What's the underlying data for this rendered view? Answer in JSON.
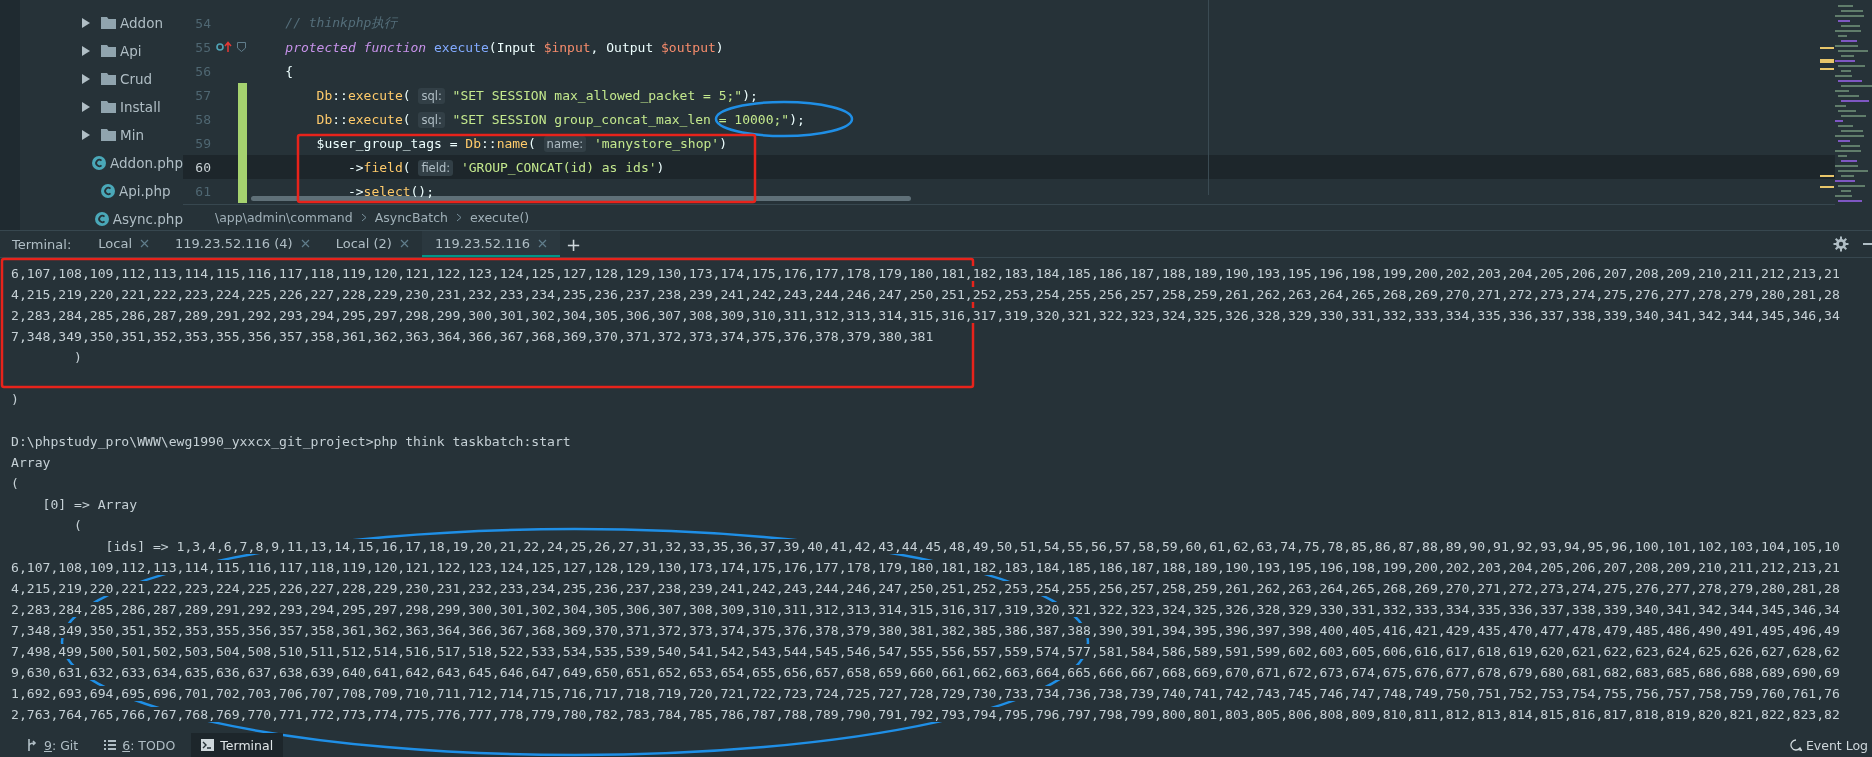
{
  "project_tree": {
    "items": [
      {
        "label": "Addon",
        "kind": "folder"
      },
      {
        "label": "Api",
        "kind": "folder"
      },
      {
        "label": "Crud",
        "kind": "folder"
      },
      {
        "label": "Install",
        "kind": "folder"
      },
      {
        "label": "Min",
        "kind": "folder"
      },
      {
        "label": "Addon.php",
        "kind": "class_file"
      },
      {
        "label": "Api.php",
        "kind": "class_file"
      },
      {
        "label": "Async.php",
        "kind": "class_file"
      }
    ]
  },
  "editor": {
    "lines": [
      {
        "number": "54",
        "changed": false,
        "current": false,
        "override": false,
        "tokens": [
          {
            "kind": "comment",
            "t": "    // thinkphp执行"
          }
        ]
      },
      {
        "number": "55",
        "changed": false,
        "current": false,
        "override": true,
        "tokens": [
          {
            "kind": "keyword",
            "t": "    protected"
          },
          {
            "kind": "keyword",
            "t": " function"
          },
          {
            "kind": "decl",
            "t": " execute"
          },
          {
            "kind": "plain",
            "t": "(Input "
          },
          {
            "kind": "var",
            "t": "$input"
          },
          {
            "kind": "plain",
            "t": ", Output "
          },
          {
            "kind": "var",
            "t": "$output"
          },
          {
            "kind": "plain",
            "t": ")"
          }
        ]
      },
      {
        "number": "56",
        "changed": false,
        "current": false,
        "override": false,
        "tokens": [
          {
            "kind": "plain",
            "t": "    {"
          }
        ]
      },
      {
        "number": "57",
        "changed": true,
        "current": false,
        "override": false,
        "tokens": [
          {
            "kind": "class",
            "t": "        Db"
          },
          {
            "kind": "plain",
            "t": "::"
          },
          {
            "kind": "method",
            "t": "execute"
          },
          {
            "kind": "plain",
            "t": "( "
          },
          {
            "kind": "hint",
            "t": "sql:"
          },
          {
            "kind": "string",
            "t": " \"SET SESSION max_allowed_packet = 5;\""
          },
          {
            "kind": "plain",
            "t": ");"
          }
        ]
      },
      {
        "number": "58",
        "changed": true,
        "current": false,
        "override": false,
        "tokens": [
          {
            "kind": "class",
            "t": "        Db"
          },
          {
            "kind": "plain",
            "t": "::"
          },
          {
            "kind": "method",
            "t": "execute"
          },
          {
            "kind": "plain",
            "t": "( "
          },
          {
            "kind": "hint",
            "t": "sql:"
          },
          {
            "kind": "string",
            "t": " \"SET SESSION group_concat_max_len = 10000;\""
          },
          {
            "kind": "plain",
            "t": ");"
          }
        ]
      },
      {
        "number": "59",
        "changed": true,
        "current": false,
        "override": false,
        "tokens": [
          {
            "kind": "plain",
            "t": "        $user_group_tags = "
          },
          {
            "kind": "class",
            "t": "Db"
          },
          {
            "kind": "plain",
            "t": "::"
          },
          {
            "kind": "method",
            "t": "name"
          },
          {
            "kind": "plain",
            "t": "( "
          },
          {
            "kind": "hint",
            "t": "name:"
          },
          {
            "kind": "string",
            "t": " 'manystore_shop'"
          },
          {
            "kind": "plain",
            "t": ")"
          }
        ]
      },
      {
        "number": "60",
        "changed": true,
        "current": true,
        "override": false,
        "tokens": [
          {
            "kind": "plain",
            "t": "            ->"
          },
          {
            "kind": "method",
            "t": "field"
          },
          {
            "kind": "plain",
            "t": "( "
          },
          {
            "kind": "hint",
            "t": "field:"
          },
          {
            "kind": "string",
            "t": " 'GROUP_CONCAT(id) as ids'"
          },
          {
            "kind": "plain",
            "t": ")"
          }
        ]
      },
      {
        "number": "61",
        "changed": true,
        "current": false,
        "override": false,
        "tokens": [
          {
            "kind": "plain",
            "t": "            ->"
          },
          {
            "kind": "method",
            "t": "select"
          },
          {
            "kind": "plain",
            "t": "();"
          }
        ]
      }
    ]
  },
  "breadcrumb": [
    "\\app\\admin\\command",
    "AsyncBatch",
    "execute()"
  ],
  "terminal": {
    "label": "Terminal:",
    "tabs": [
      {
        "label": "Local",
        "selected": false
      },
      {
        "label": "119.23.52.116 (4)",
        "selected": false
      },
      {
        "label": "Local (2)",
        "selected": false
      },
      {
        "label": "119.23.52.116",
        "selected": true
      }
    ],
    "add": "+",
    "blocks": [
      {
        "lines": [
          "6,107,108,109,112,113,114,115,116,117,118,119,120,121,122,123,124,125,127,128,129,130,173,174,175,176,177,178,179,180,181,182,183,184,185,186,187,188,189,190,193,195,196,198,199,200,202,203,204,205,206,207,208,209,210,211,212,213,21",
          "4,215,219,220,221,222,223,224,225,226,227,228,229,230,231,232,233,234,235,236,237,238,239,241,242,243,244,246,247,250,251,252,253,254,255,256,257,258,259,261,262,263,264,265,268,269,270,271,272,273,274,275,276,277,278,279,280,281,28",
          "2,283,284,285,286,287,289,291,292,293,294,295,297,298,299,300,301,302,304,305,306,307,308,309,310,311,312,313,314,315,316,317,319,320,321,322,323,324,325,326,328,329,330,331,332,333,334,335,336,337,338,339,340,341,342,344,345,346,34",
          "7,348,349,350,351,352,353,355,356,357,358,361,362,363,364,366,367,368,369,370,371,372,373,374,375,376,378,379,380,381",
          "        )"
        ]
      },
      {
        "lines": [
          ")"
        ]
      },
      {
        "lines": [
          "D:\\phpstudy_pro\\WWW\\ewg1990_yxxcx_git_project>php think taskbatch:start",
          "Array",
          "(",
          "    [0] => Array",
          "        (",
          "            [ids] => 1,3,4,6,7,8,9,11,13,14,15,16,17,18,19,20,21,22,24,25,26,27,31,32,33,35,36,37,39,40,41,42,43,44,45,48,49,50,51,54,55,56,57,58,59,60,61,62,63,74,75,78,85,86,87,88,89,90,91,92,93,94,95,96,100,101,102,103,104,105,10",
          "6,107,108,109,112,113,114,115,116,117,118,119,120,121,122,123,124,125,127,128,129,130,173,174,175,176,177,178,179,180,181,182,183,184,185,186,187,188,189,190,193,195,196,198,199,200,202,203,204,205,206,207,208,209,210,211,212,213,21",
          "4,215,219,220,221,222,223,224,225,226,227,228,229,230,231,232,233,234,235,236,237,238,239,241,242,243,244,246,247,250,251,252,253,254,255,256,257,258,259,261,262,263,264,265,268,269,270,271,272,273,274,275,276,277,278,279,280,281,28",
          "2,283,284,285,286,287,289,291,292,293,294,295,297,298,299,300,301,302,304,305,306,307,308,309,310,311,312,313,314,315,316,317,319,320,321,322,323,324,325,326,328,329,330,331,332,333,334,335,336,337,338,339,340,341,342,344,345,346,34",
          "7,348,349,350,351,352,353,355,356,357,358,361,362,363,364,366,367,368,369,370,371,372,373,374,375,376,378,379,380,381,382,385,386,387,388,390,391,394,395,396,397,398,400,405,416,421,429,435,470,477,478,479,485,486,490,491,495,496,49",
          "7,498,499,500,501,502,503,504,508,510,511,512,514,516,517,518,522,533,534,535,539,540,541,542,543,544,545,546,547,555,556,557,559,574,577,581,584,586,589,591,599,602,603,605,606,616,617,618,619,620,621,622,623,624,625,626,627,628,62",
          "9,630,631,632,633,634,635,636,637,638,639,640,641,642,643,645,646,647,649,650,651,652,653,654,655,656,657,658,659,660,661,662,663,664,665,666,667,668,669,670,671,672,673,674,675,676,677,678,679,680,681,682,683,685,686,688,689,690,69",
          "1,692,693,694,695,696,701,702,703,706,707,708,709,710,711,712,714,715,716,717,718,719,720,721,722,723,724,725,727,728,729,730,733,734,736,738,739,740,741,742,743,745,746,747,748,749,750,751,752,753,754,755,756,757,758,759,760,761,76",
          "2,763,764,765,766,767,768,769,770,771,772,773,774,775,776,777,778,779,780,782,783,784,785,786,787,788,789,790,791,792,793,794,795,796,797,798,799,800,801,803,805,806,808,809,810,811,812,813,814,815,816,817,818,819,820,821,822,823,82"
        ]
      }
    ]
  },
  "tool_windows": [
    {
      "mnemonic": "9",
      "label": ": Git",
      "selected": false,
      "kind": "git"
    },
    {
      "mnemonic": "6",
      "label": ": TODO",
      "selected": false,
      "kind": "todo"
    },
    {
      "label": "Terminal",
      "selected": true,
      "kind": "terminal"
    }
  ],
  "event_log": "Event Log",
  "annotations": [
    {
      "kind": "rectangle",
      "color": "#e8231b"
    },
    {
      "kind": "ellipse",
      "color": "#1f8fe6"
    },
    {
      "kind": "rectangle",
      "color": "#e8231b"
    },
    {
      "kind": "ellipse",
      "color": "#1f8fe6"
    }
  ]
}
